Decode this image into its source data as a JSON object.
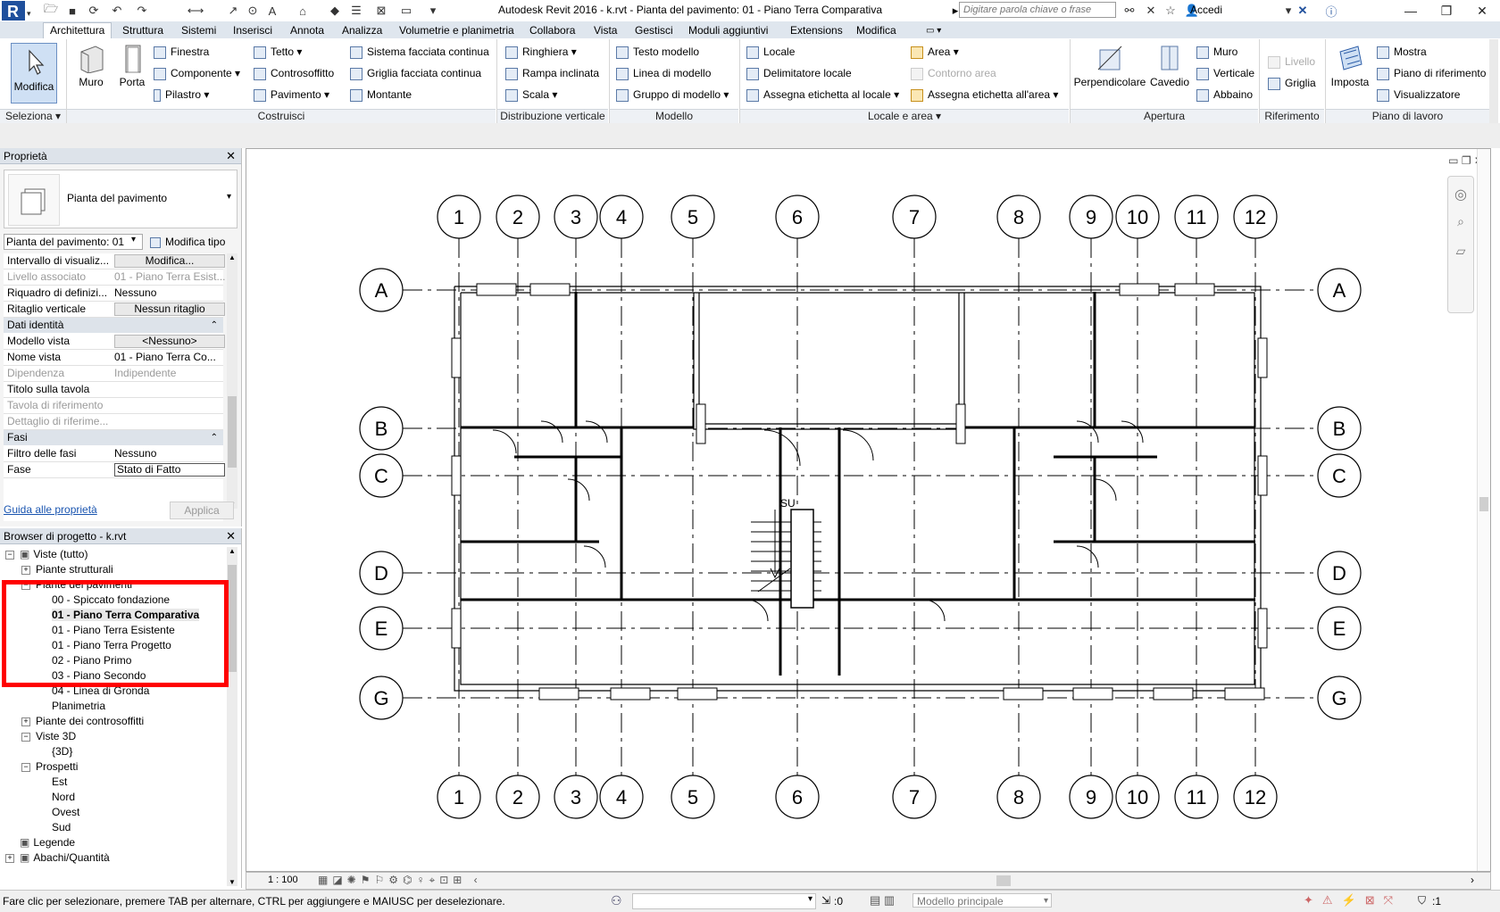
{
  "app": {
    "title": "Autodesk Revit 2016 -     k.rvt - Pianta del pavimento: 01 - Piano Terra Comparativa",
    "search_placeholder": "Digitare parola chiave o frase",
    "signin": "Accedi"
  },
  "tabs": [
    "Architettura",
    "Struttura",
    "Sistemi",
    "Inserisci",
    "Annota",
    "Analizza",
    "Volumetrie e planimetria",
    "Collabora",
    "Vista",
    "Gestisci",
    "Moduli aggiuntivi",
    "Extensions",
    "Modifica"
  ],
  "ribbon": {
    "modifica": "Modifica",
    "muro": "Muro",
    "porta": "Porta",
    "finestra": "Finestra",
    "componente": "Componente",
    "pilastro": "Pilastro",
    "tetto": "Tetto",
    "controsoffitto": "Controsoffitto",
    "pavimento": "Pavimento",
    "sistema_facciata": "Sistema facciata continua",
    "griglia_facciata": "Griglia facciata continua",
    "montante": "Montante",
    "ringhiera": "Ringhiera",
    "rampa": "Rampa inclinata",
    "scala": "Scala",
    "testo_modello": "Testo modello",
    "linea_modello": "Linea di modello",
    "gruppo_modello": "Gruppo di modello",
    "locale": "Locale",
    "delimitatore": "Delimitatore  locale",
    "assegna_locale": "Assegna etichetta  al locale",
    "area": "Area",
    "contorno_area": "Contorno  area",
    "assegna_area": "Assegna etichetta  all'area",
    "perpendicolare": "Perpendicolare",
    "cavedio": "Cavedio",
    "muro_ap": "Muro",
    "verticale": "Verticale",
    "abbaino": "Abbaino",
    "livello": "Livello",
    "griglia": "Griglia",
    "imposta": "Imposta",
    "mostra": "Mostra",
    "piano_rif": "Piano di riferimento",
    "visualizzatore": "Visualizzatore",
    "panels": {
      "seleziona": "Seleziona",
      "costruisci": "Costruisci",
      "distribuzione": "Distribuzione verticale",
      "modello": "Modello",
      "locale_area": "Locale e area",
      "apertura": "Apertura",
      "riferimento": "Riferimento",
      "piano_lavoro": "Piano di lavoro"
    }
  },
  "properties": {
    "header": "Proprietà",
    "type_name": "Pianta del pavimento",
    "instance_select": "Pianta del pavimento: 01",
    "edit_type": "Modifica tipo",
    "rows": [
      {
        "label": "Intervallo di visualiz...",
        "value": "Modifica...",
        "button": true
      },
      {
        "label": "Livello associato",
        "value": "01 - Piano Terra Esist...",
        "disabled": true
      },
      {
        "label": "Riquadro di definizi...",
        "value": "Nessuno"
      },
      {
        "label": "Ritaglio verticale",
        "value": "Nessun ritaglio",
        "button": true
      }
    ],
    "group_identity": "Dati identità",
    "identity_rows": [
      {
        "label": "Modello vista",
        "value": "<Nessuno>",
        "button": true
      },
      {
        "label": "Nome vista",
        "value": "01 - Piano Terra Co..."
      },
      {
        "label": "Dipendenza",
        "value": "Indipendente",
        "disabled": true
      },
      {
        "label": "Titolo sulla tavola",
        "value": ""
      },
      {
        "label": "Tavola di riferimento",
        "value": "",
        "disabled": true
      },
      {
        "label": "Dettaglio di riferime...",
        "value": "",
        "disabled": true
      }
    ],
    "group_phases": "Fasi",
    "phase_rows": [
      {
        "label": "Filtro delle fasi",
        "value": "Nessuno"
      },
      {
        "label": "Fase",
        "value": "Stato di Fatto"
      }
    ],
    "help_link": "Guida alle proprietà",
    "apply": "Applica"
  },
  "browser": {
    "header": "Browser di progetto - k.rvt",
    "items": [
      {
        "text": "Viste (tutto)",
        "level": 0,
        "toggle": "−",
        "icon": true
      },
      {
        "text": "Piante strutturali",
        "level": 1,
        "toggle": "+"
      },
      {
        "text": "Piante dei pavimenti",
        "level": 1,
        "toggle": "−"
      },
      {
        "text": "00 - Spiccato fondazione",
        "level": 2
      },
      {
        "text": "01 - Piano Terra Comparativa",
        "level": 2,
        "bold": true
      },
      {
        "text": "01 - Piano Terra Esistente",
        "level": 2
      },
      {
        "text": "01 - Piano Terra Progetto",
        "level": 2
      },
      {
        "text": "02 - Piano Primo",
        "level": 2
      },
      {
        "text": "03 - Piano Secondo",
        "level": 2
      },
      {
        "text": "04 - Linea di Gronda",
        "level": 2
      },
      {
        "text": "Planimetria",
        "level": 2
      },
      {
        "text": "Piante dei controsoffitti",
        "level": 1,
        "toggle": "+"
      },
      {
        "text": "Viste 3D",
        "level": 1,
        "toggle": "−"
      },
      {
        "text": "{3D}",
        "level": 2
      },
      {
        "text": "Prospetti",
        "level": 1,
        "toggle": "−"
      },
      {
        "text": "Est",
        "level": 2
      },
      {
        "text": "Nord",
        "level": 2
      },
      {
        "text": "Ovest",
        "level": 2
      },
      {
        "text": "Sud",
        "level": 2
      },
      {
        "text": "Legende",
        "level": 0,
        "icon": true
      },
      {
        "text": "Abachi/Quantità",
        "level": 0,
        "toggle": "+",
        "icon": true
      }
    ]
  },
  "drawing": {
    "cols": [
      "1",
      "2",
      "3",
      "4",
      "5",
      "6",
      "7",
      "8",
      "9",
      "10",
      "11",
      "12"
    ],
    "rows": [
      "A",
      "B",
      "C",
      "D",
      "E",
      "G"
    ],
    "stair_label": "SU"
  },
  "viewbar": {
    "scale": "1 : 100"
  },
  "status": {
    "message": "Fare clic per selezionare, premere TAB per alternare, CTRL per aggiungere e MAIUSC per deselezionare.",
    "count": ":0",
    "model": "Modello principale",
    "filter": ":1"
  },
  "colors": {
    "accent": "#2d5ea8",
    "highlight": "#ff0000",
    "tabbar": "#dfe6ee"
  }
}
